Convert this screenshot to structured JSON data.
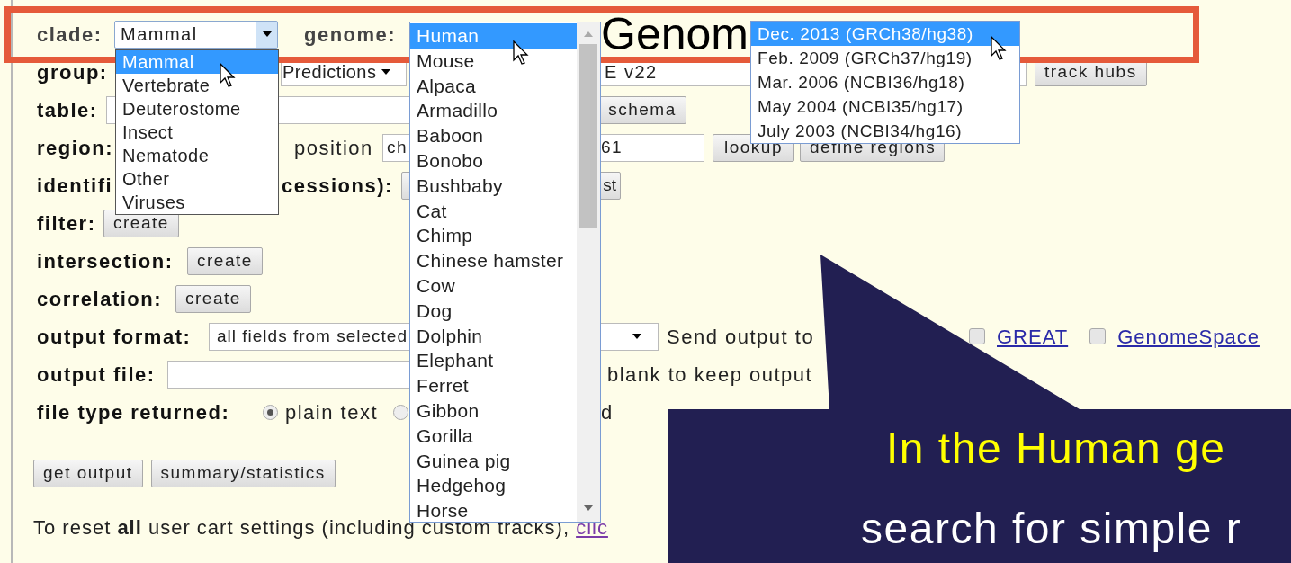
{
  "form": {
    "clade": {
      "label": "clade:",
      "value": "Mammal"
    },
    "genome": {
      "label": "genome:"
    },
    "group": {
      "label": "group:",
      "group_value": "Predictions",
      "track_value": "E v22",
      "track_hubs": "track hubs"
    },
    "table": {
      "label": "table:",
      "schema": "schema"
    },
    "region": {
      "label": "region:",
      "position_label": "position",
      "position_start": "ch",
      "position_end": "61",
      "lookup": "lookup",
      "define_regions": "define regions"
    },
    "identifiers": {
      "label_start": "identifi",
      "label_end": "cessions):",
      "button_end": "st"
    },
    "filter": {
      "label": "filter:",
      "button": "create"
    },
    "intersection": {
      "label": "intersection:",
      "button": "create"
    },
    "correlation": {
      "label": "correlation:",
      "button": "create"
    },
    "output_format": {
      "label": "output format:",
      "value": "all fields from selected",
      "send_label": "Send output to",
      "targets": [
        {
          "label": "GREAT",
          "checked": false
        },
        {
          "label": "GenomeSpace",
          "checked": false
        }
      ]
    },
    "output_file": {
      "label": "output file:",
      "hint": "blank to keep output"
    },
    "file_type": {
      "label": "file type returned:",
      "options": [
        {
          "label": "plain text",
          "selected": true
        },
        {
          "label": "d",
          "selected": false
        }
      ]
    },
    "buttons": [
      "get output",
      "summary/statistics"
    ],
    "reset_note": {
      "text": "To reset **all** user cart settings (including custom tracks),",
      "link": "clic"
    }
  },
  "clade_list": [
    {
      "label": "Mammal",
      "selected": true
    },
    {
      "label": "Vertebrate",
      "selected": false
    },
    {
      "label": "Deuterostome",
      "selected": false
    },
    {
      "label": "Insect",
      "selected": false
    },
    {
      "label": "Nematode",
      "selected": false
    },
    {
      "label": "Other",
      "selected": false
    },
    {
      "label": "Viruses",
      "selected": false
    }
  ],
  "genome_list": [
    {
      "label": "Human",
      "selected": true
    },
    {
      "label": "Mouse",
      "selected": false
    },
    {
      "label": "Alpaca",
      "selected": false
    },
    {
      "label": "Armadillo",
      "selected": false
    },
    {
      "label": "Baboon",
      "selected": false
    },
    {
      "label": "Bonobo",
      "selected": false
    },
    {
      "label": "Bushbaby",
      "selected": false
    },
    {
      "label": "Cat",
      "selected": false
    },
    {
      "label": "Chimp",
      "selected": false
    },
    {
      "label": "Chinese hamster",
      "selected": false
    },
    {
      "label": "Cow",
      "selected": false
    },
    {
      "label": "Dog",
      "selected": false
    },
    {
      "label": "Dolphin",
      "selected": false
    },
    {
      "label": "Elephant",
      "selected": false
    },
    {
      "label": "Ferret",
      "selected": false
    },
    {
      "label": "Gibbon",
      "selected": false
    },
    {
      "label": "Gorilla",
      "selected": false
    },
    {
      "label": "Guinea pig",
      "selected": false
    },
    {
      "label": "Hedgehog",
      "selected": false
    },
    {
      "label": "Horse",
      "selected": false
    }
  ],
  "assembly_list": [
    {
      "label": "Dec. 2013 (GRCh38/hg38)",
      "selected": true
    },
    {
      "label": "Feb. 2009 (GRCh37/hg19)",
      "selected": false
    },
    {
      "label": "Mar. 2006 (NCBI36/hg18)",
      "selected": false
    },
    {
      "label": "May 2004 (NCBI35/hg17)",
      "selected": false
    },
    {
      "label": "July 2003 (NCBI34/hg16)",
      "selected": false
    }
  ],
  "annotation": {
    "title": "Genom",
    "callout_line_1": "In the Human ge",
    "callout_line_2": "search for simple r"
  }
}
